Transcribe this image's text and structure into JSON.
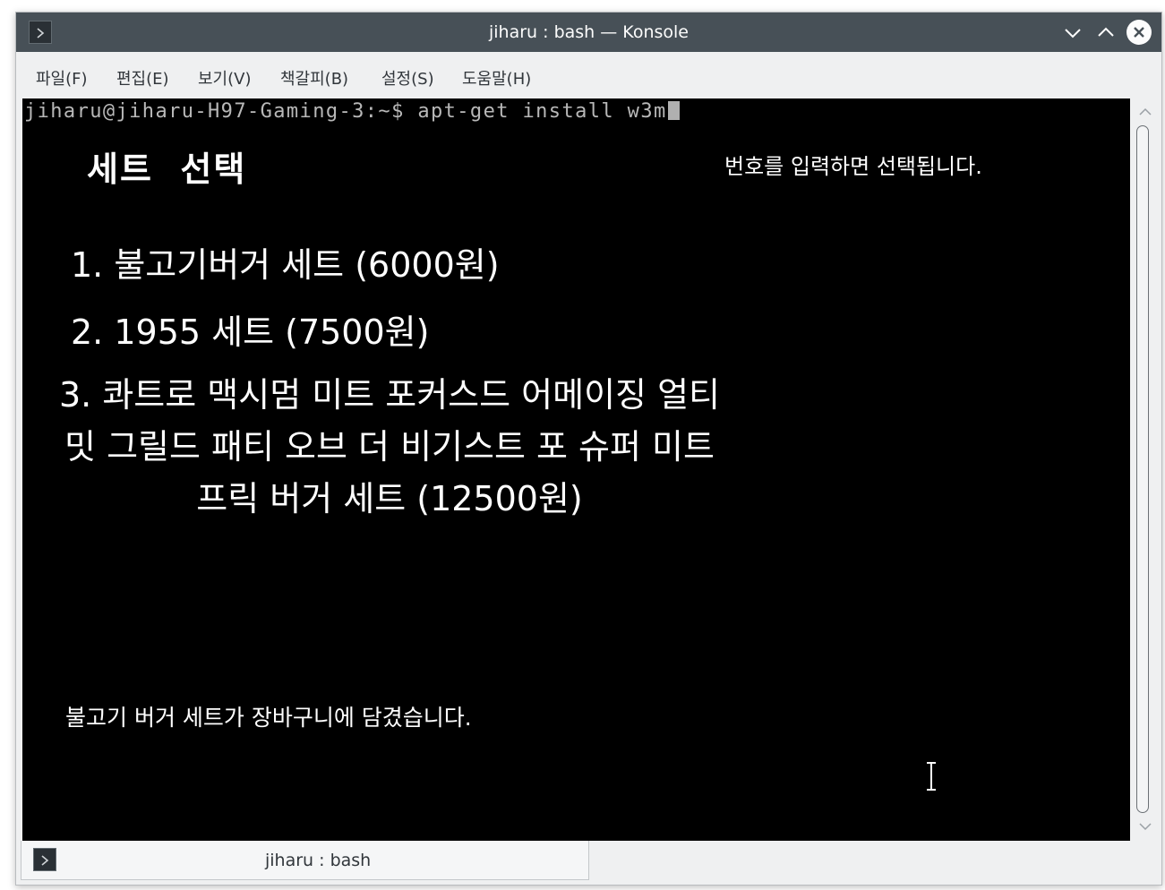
{
  "window": {
    "title": "jiharu : bash — Konsole"
  },
  "menubar": {
    "items": [
      "파일(F)",
      "편집(E)",
      "보기(V)",
      "책갈피(B)",
      "설정(S)",
      "도움말(H)"
    ]
  },
  "terminal": {
    "prompt": "jiharu@jiharu-H97-Gaming-3:~$ apt-get install w3m",
    "heading": "세트  선택",
    "instruction": "번호를 입력하면 선택됩니다.",
    "options": [
      "1. 불고기버거 세트 (6000원)",
      "2. 1955 세트 (7500원)",
      "3. 콰트로 맥시멈 미트 포커스드 어메이징 얼티밋 그릴드 패티 오브 더 비기스트 포 슈퍼 미트 프릭 버거 세트 (12500원)"
    ],
    "cart_message": "불고기 버거 세트가 장바구니에 담겼습니다."
  },
  "tab": {
    "label": "jiharu : bash"
  },
  "colors": {
    "titlebar": "#475057",
    "terminal_bg": "#000000",
    "terminal_text": "#ffffff",
    "chrome_bg": "#eff0f1"
  },
  "icons": [
    "terminal-app-icon",
    "chevron-down-icon",
    "chevron-up-icon",
    "close-icon",
    "scroll-up-icon",
    "scroll-down-icon",
    "text-cursor-icon"
  ]
}
